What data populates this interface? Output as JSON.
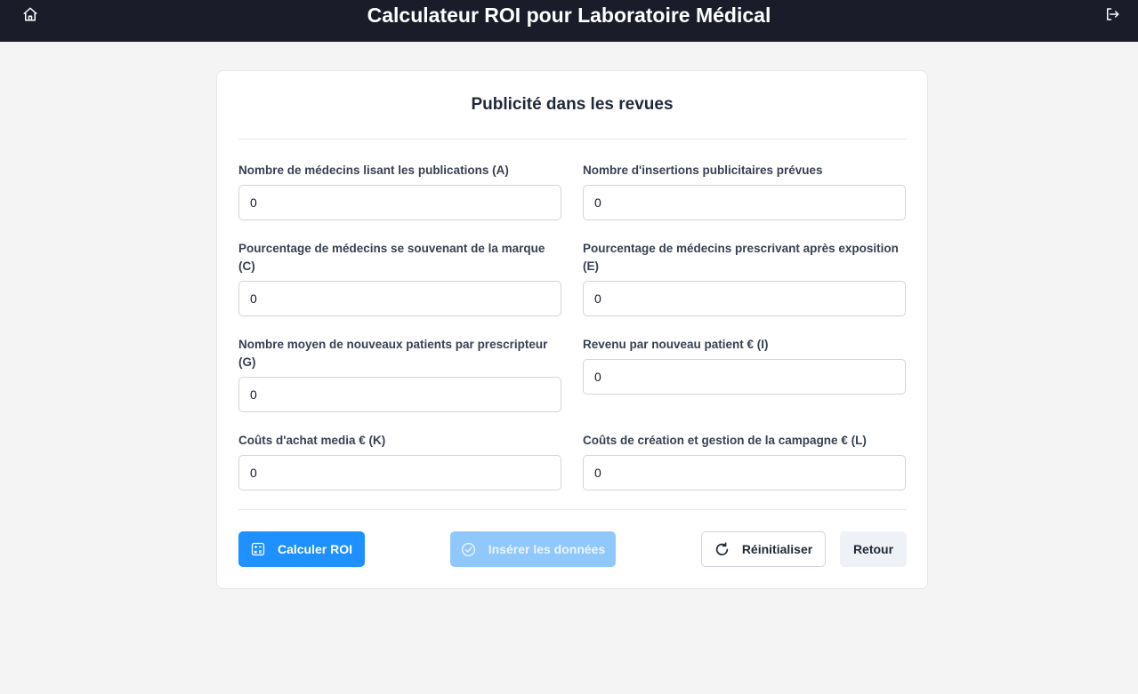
{
  "header": {
    "title": "Calculateur ROI pour Laboratoire Médical",
    "home_icon": "home-icon",
    "logout_icon": "logout-icon"
  },
  "form": {
    "title": "Publicité dans les revues",
    "fields": [
      {
        "label": "Nombre de médecins lisant les publications (A)",
        "value": "0"
      },
      {
        "label": "Nombre d'insertions publicitaires prévues",
        "value": "0"
      },
      {
        "label": "Pourcentage de médecins se souvenant de la marque (C)",
        "value": "0"
      },
      {
        "label": "Pourcentage de médecins prescrivant après exposition (E)",
        "value": "0"
      },
      {
        "label": "Nombre moyen de nouveaux patients par prescripteur (G)",
        "value": "0"
      },
      {
        "label": "Revenu par nouveau patient € (I)",
        "value": "0"
      },
      {
        "label": "Coûts d'achat media € (K)",
        "value": "0"
      },
      {
        "label": "Coûts de création et gestion de la campagne € (L)",
        "value": "0"
      }
    ]
  },
  "actions": {
    "calculate_label": "Calculer ROI",
    "insert_label": "Insérer les données",
    "reset_label": "Réinitialiser",
    "back_label": "Retour"
  },
  "colors": {
    "header_bg": "#1a1d29",
    "primary": "#1e90ff",
    "primary_disabled": "#90c8fb",
    "page_bg": "#f4f4f5"
  }
}
